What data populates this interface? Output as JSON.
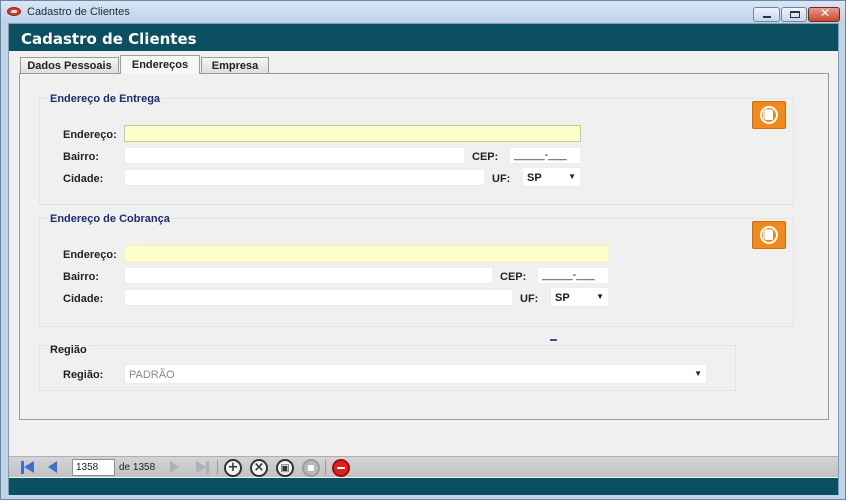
{
  "window": {
    "title": "Cadastro de Clientes"
  },
  "header": {
    "title": "Cadastro de Clientes"
  },
  "tabs": [
    {
      "label": "Dados Pessoais",
      "active": false
    },
    {
      "label": "Endereços",
      "active": true
    },
    {
      "label": "Empresa",
      "active": false
    }
  ],
  "entrega": {
    "group_title": "Endereço de Entrega",
    "endereco_label": "Endereço:",
    "endereco_value": "",
    "bairro_label": "Bairro:",
    "bairro_value": "",
    "cep_label": "CEP:",
    "cep_value": "_____-___",
    "cidade_label": "Cidade:",
    "cidade_value": "",
    "uf_label": "UF:",
    "uf_value": "SP"
  },
  "cobranca": {
    "group_title": "Endereço de Cobrança",
    "endereco_label": "Endereço:",
    "endereco_value": "",
    "bairro_label": "Bairro:",
    "bairro_value": "",
    "cep_label": "CEP:",
    "cep_value": "_____-___",
    "cidade_label": "Cidade:",
    "cidade_value": "",
    "uf_label": "UF:",
    "uf_value": "SP"
  },
  "regiao": {
    "group_title": "Região",
    "label": "Região:",
    "value": "PADRÃO"
  },
  "navigator": {
    "record_number": "1358",
    "record_of": "de 1358"
  },
  "colors": {
    "header_band": "#0b4f61",
    "focus_field": "#ffffcc",
    "copy_button": "#f08a1e",
    "nav_arrow_active": "#3d6fd1",
    "delete_button": "#e32020"
  },
  "icons": {
    "copy_address": "copy-address-icon",
    "first": "first-record-icon",
    "prev": "previous-record-icon",
    "next": "next-record-icon",
    "last": "last-record-icon",
    "add": "add-icon",
    "cancel": "cancel-icon",
    "save": "save-icon",
    "disabled": "refresh-icon",
    "delete": "delete-icon"
  }
}
